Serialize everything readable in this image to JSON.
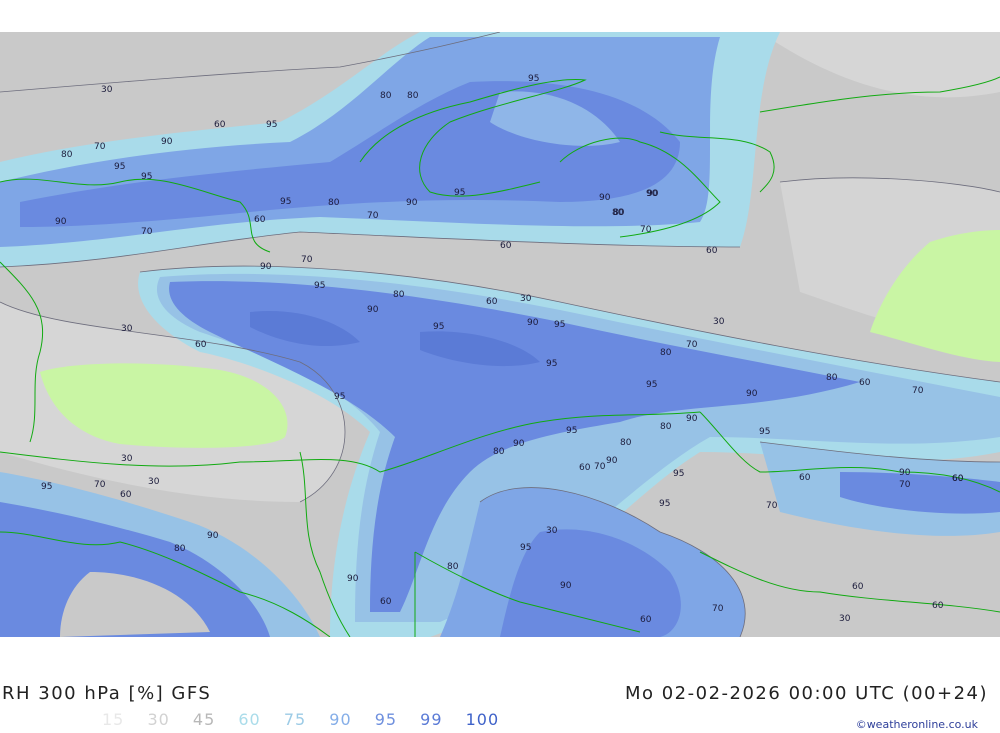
{
  "title": {
    "product": "RH 300 hPa [%] GFS",
    "datetime": "Mo 02-02-2026 00:00 UTC (00+24)"
  },
  "legend": {
    "values": [
      "15",
      "30",
      "45",
      "60",
      "75",
      "90",
      "95",
      "99",
      "100"
    ],
    "colors": [
      "#e8e8e8",
      "#d2d2d2",
      "#b8b8b8",
      "#aadcea",
      "#9ccbe6",
      "#85aee8",
      "#6f90de",
      "#5b7bd6",
      "#3f62c9"
    ]
  },
  "credit": "©weatheronline.co.uk",
  "map": {
    "contour_labels": [
      "95",
      "80",
      "80",
      "30",
      "60",
      "95",
      "90",
      "70",
      "80",
      "95",
      "95",
      "95",
      "80",
      "70",
      "90",
      "90",
      "95",
      "80",
      "90",
      "60",
      "70",
      "90",
      "60",
      "95",
      "90",
      "80",
      "70",
      "60",
      "90",
      "70",
      "95",
      "80",
      "60",
      "30",
      "90",
      "30",
      "95",
      "60",
      "90",
      "95",
      "95",
      "80",
      "70",
      "30",
      "80",
      "60",
      "70",
      "95",
      "90",
      "95",
      "95",
      "90",
      "80",
      "30",
      "80",
      "90",
      "60",
      "70",
      "90",
      "95",
      "60",
      "80",
      "90",
      "70",
      "60",
      "60",
      "30",
      "95",
      "70",
      "95",
      "30",
      "80",
      "60",
      "95",
      "90",
      "90",
      "80",
      "60",
      "70",
      "90",
      "60",
      "60",
      "30",
      "60",
      "70"
    ],
    "colors": {
      "background_gray": "#c9c9c9",
      "light_gray": "#d6d6d6",
      "dark_gray": "#b3b3b3",
      "cyan": "#a9dbea",
      "light_blue": "#97c2e6",
      "mid_blue": "#7fa6e6",
      "blue": "#6a8ae0",
      "dry_green": "#c9f5a4",
      "border_green": "#11aa11"
    }
  }
}
